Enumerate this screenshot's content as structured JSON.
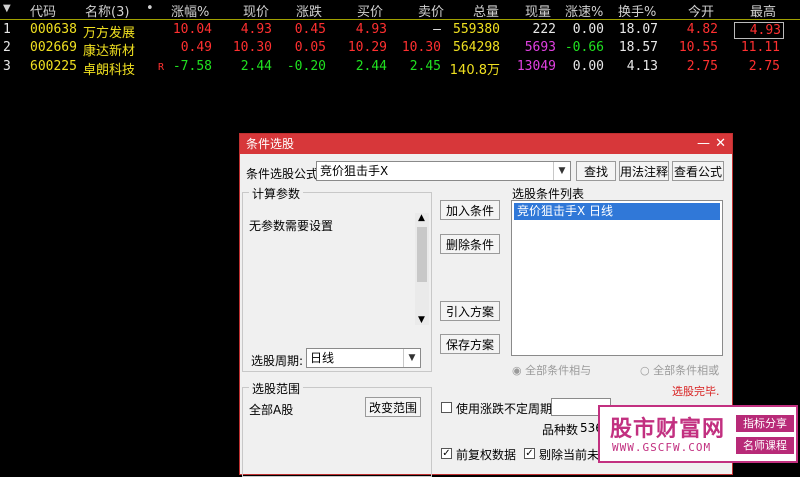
{
  "table": {
    "headers": [
      "代码",
      "名称(3)",
      "涨幅%",
      "现价",
      "涨跌",
      "买价",
      "卖价",
      "总量",
      "现量",
      "涨速%",
      "换手%",
      "今开",
      "最高"
    ],
    "rows": [
      {
        "idx": "1",
        "code": "000638",
        "name": "万方发展",
        "flag": "",
        "pct": "10.04",
        "price": "4.93",
        "chg": "0.45",
        "bid": "4.93",
        "ask": "—",
        "vol": "559380",
        "cur": "222",
        "speed": "0.00",
        "turn": "18.07",
        "open": "4.82",
        "high": "4.93"
      },
      {
        "idx": "2",
        "code": "002669",
        "name": "康达新材",
        "flag": "",
        "pct": "0.49",
        "price": "10.30",
        "chg": "0.05",
        "bid": "10.29",
        "ask": "10.30",
        "vol": "564298",
        "cur": "5693",
        "speed": "-0.66",
        "turn": "18.57",
        "open": "10.55",
        "high": "11.11"
      },
      {
        "idx": "3",
        "code": "600225",
        "name": "卓朗科技",
        "flag": "R",
        "pct": "-7.58",
        "price": "2.44",
        "chg": "-0.20",
        "bid": "2.44",
        "ask": "2.45",
        "vol": "140.8万",
        "cur": "13049",
        "speed": "0.00",
        "turn": "4.13",
        "open": "2.75",
        "high": "2.75"
      }
    ]
  },
  "dialog": {
    "title": "条件选股",
    "formula_label": "条件选股公式",
    "formula_value": "竞价狙击手X",
    "btn_find": "查找",
    "btn_usage": "用法注释",
    "btn_view": "查看公式",
    "params_title": "计算参数",
    "params_text": "无参数需要设置",
    "period_label": "选股周期:",
    "period_value": "日线",
    "btn_add": "加入条件",
    "btn_delete": "删除条件",
    "btn_import": "引入方案",
    "btn_save": "保存方案",
    "list_title": "选股条件列表",
    "list_items": [
      "竞价狙击手X  日线"
    ],
    "radio_and": "全部条件相与",
    "radio_or": "全部条件相或",
    "status": "选股完毕.",
    "range_title": "选股范围",
    "range_value": "全部A股",
    "btn_range": "改变范围",
    "chk_undefined": "使用涨跌不定周期",
    "count_label": "品种数",
    "count_value": "536",
    "chk_adjust": "前复权数据",
    "chk_remove": "剔除当前未交"
  },
  "watermark": {
    "title": "股市财富网",
    "url": "WWW.GSCFW.COM",
    "tag1": "指标分享",
    "tag2": "名师课程"
  }
}
